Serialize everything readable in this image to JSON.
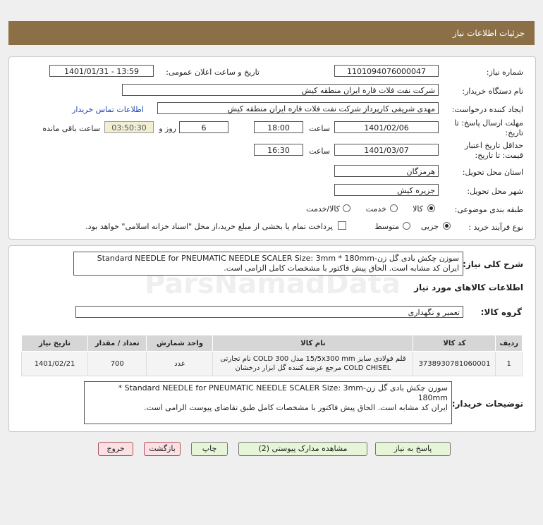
{
  "header": {
    "title": "جزئیات اطلاعات نیاز"
  },
  "form": {
    "need_number_label": "شماره نیاز:",
    "need_number": "1101094076000047",
    "announce_label": "تاریخ و ساعت اعلان عمومی:",
    "announce_value": "1401/01/31 - 13:59",
    "buyer_org_label": "نام دستگاه خریدار:",
    "buyer_org": "شرکت نفت فلات قاره ایران منطقه کیش",
    "requester_label": "ایجاد کننده درخواست:",
    "requester": "مهدی شریفی کارپرداز شرکت نفت فلات قاره ایران منطقه کیش",
    "contact_link": "اطلاعات تماس خریدار",
    "deadline_label": "مهلت ارسال پاسخ: تا تاریخ:",
    "deadline_date": "1401/02/06",
    "time_label": "ساعت",
    "deadline_time": "18:00",
    "days": "6",
    "days_label": "روز و",
    "remaining": "03:50:30",
    "remaining_label": "ساعت باقی مانده",
    "validity_label": "حداقل تاریخ اعتبار قیمت: تا تاریخ:",
    "validity_date": "1401/03/07",
    "validity_time_label": "ساعت",
    "validity_time": "16:30",
    "province_label": "استان محل تحویل:",
    "province": "هرمزگان",
    "city_label": "شهر محل تحویل:",
    "city": "جزیره کیش",
    "category_label": "طبقه بندی موضوعی:",
    "category_options": [
      "کالا",
      "خدمت",
      "کالا/خدمت"
    ],
    "process_label": "نوع فرآیند خرید :",
    "process_options": [
      "جزیی",
      "متوسط"
    ],
    "payment_note": "پرداخت تمام یا بخشی از مبلغ خرید،از محل \"اسناد خزانه اسلامی\" خواهد بود."
  },
  "description": {
    "label": "شرح کلی نیاز:",
    "line1": "سوزن چکش بادی گل زن-Standard NEEDLE for PNEUMATIC NEEDLE SCALER Size: 3mm * 180mm",
    "line2": "ایران کد مشابه است. الحاق پیش فاکتور با مشخصات کامل الزامی است."
  },
  "goods": {
    "section_title": "اطلاعات کالاهای مورد نیاز",
    "group_label": "گروه کالا:",
    "group_value": "تعمیر و نگهداری",
    "headers": [
      "ردیف",
      "کد کالا",
      "نام کالا",
      "واحد شمارش",
      "تعداد / مقدار",
      "تاریخ نیاز"
    ],
    "rows": [
      {
        "index": "1",
        "code": "3738930781060001",
        "name_line1": "قلم فولادی سایز 15/5x300 mm مدل COLD 300 نام تجارتی",
        "name_line2": "COLD CHISEL مرجع عرضه کننده گل ابزار درخشان",
        "unit": "عدد",
        "qty": "700",
        "date": "1401/02/21"
      }
    ]
  },
  "buyer_notes": {
    "label": "توضیحات خریدار:",
    "line1": "سوزن چکش بادی گل زن-Standard NEEDLE for PNEUMATIC NEEDLE SCALER Size: 3mm *",
    "line2": "180mm",
    "line3": "ایران کد مشابه است. الحاق پیش فاکتور با مشخصات کامل طبق تقاضای پیوست الزامی است."
  },
  "buttons": {
    "reply": "پاسخ به نیاز",
    "attachments": "مشاهده مدارک پیوستی (2)",
    "print": "چاپ",
    "back": "بازگشت",
    "exit": "خروج"
  },
  "watermark": {
    "brand": "ParsNamadData"
  }
}
